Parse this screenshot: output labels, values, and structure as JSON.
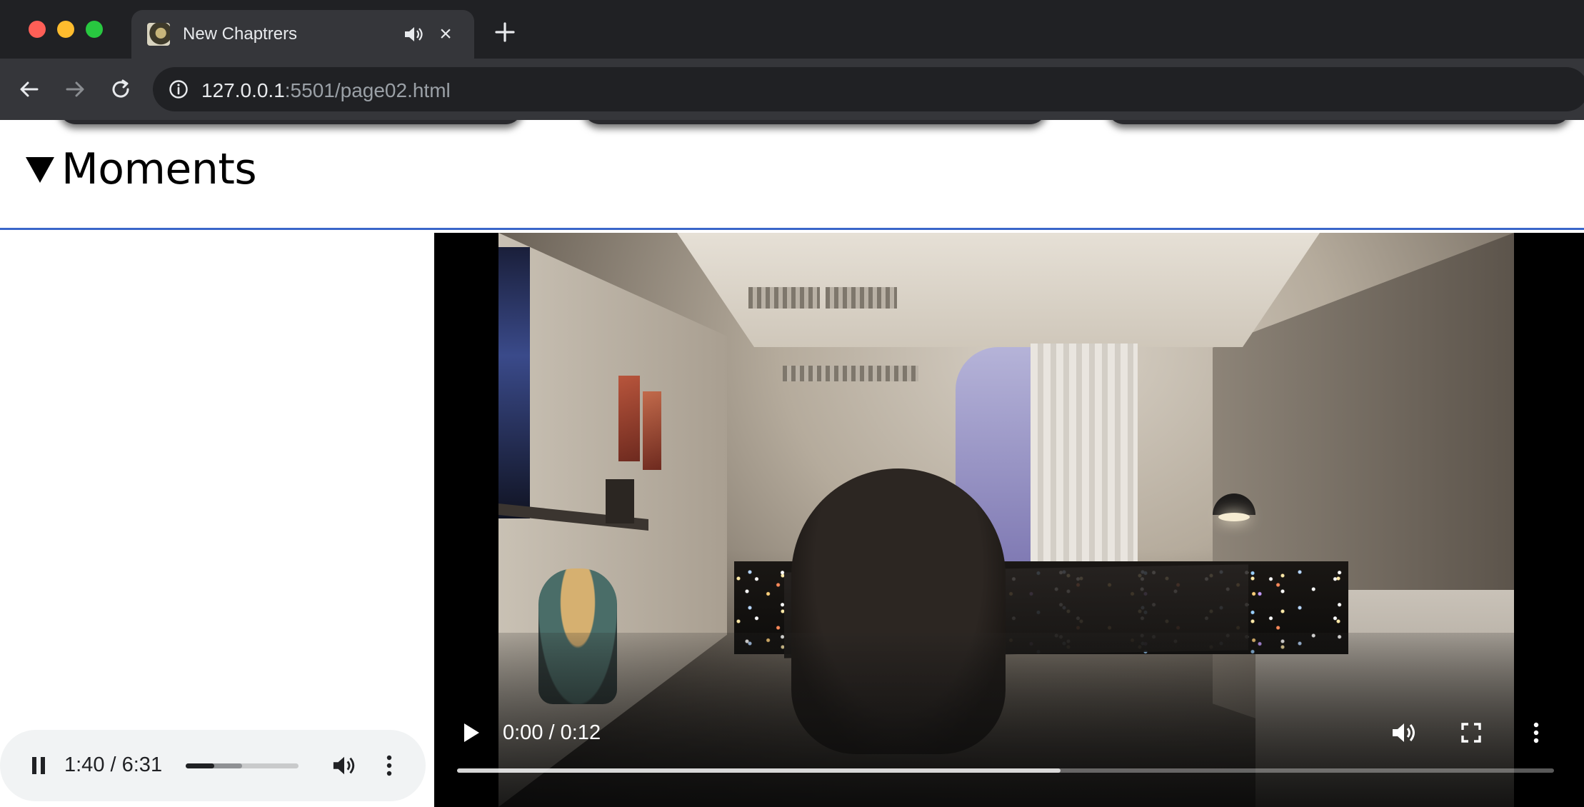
{
  "browser": {
    "tab": {
      "title": "New Chaptrers",
      "close_glyph": "×",
      "favicon": "portrait-favicon",
      "audio_icon": "speaker-icon"
    },
    "new_tab_icon": "plus-icon",
    "toolbar": {
      "back_icon": "arrow-left-icon",
      "forward_icon": "arrow-right-icon",
      "reload_icon": "reload-icon"
    },
    "omnibox": {
      "url_host": "127.0.0.1",
      "url_rest": ":5501/page02.html",
      "info_icon": "info-icon"
    }
  },
  "page": {
    "section": {
      "title": "Moments",
      "expanded": true,
      "disclosure_glyph": "▼"
    },
    "video": {
      "current_time": "0:00",
      "separator": " / ",
      "duration": "0:12",
      "buffered_fraction": 0.55,
      "played_fraction": 0,
      "playing": false
    },
    "audio": {
      "current_time": "1:40",
      "separator": " / ",
      "duration": "6:31",
      "played_fraction": 0.256,
      "buffered_fraction": 0.5,
      "playing": true
    }
  },
  "colors": {
    "tabstrip_bg": "#202124",
    "toolbar_bg": "#35363a",
    "details_border": "#3a66c9",
    "audio_bg": "#f1f3f4"
  }
}
